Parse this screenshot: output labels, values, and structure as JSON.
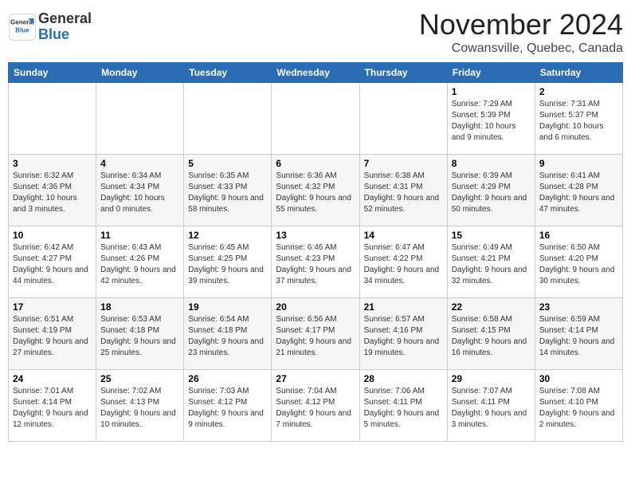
{
  "logo": {
    "general": "General",
    "blue": "Blue"
  },
  "title": "November 2024",
  "subtitle": "Cowansville, Quebec, Canada",
  "days_of_week": [
    "Sunday",
    "Monday",
    "Tuesday",
    "Wednesday",
    "Thursday",
    "Friday",
    "Saturday"
  ],
  "weeks": [
    [
      {
        "day": "",
        "info": ""
      },
      {
        "day": "",
        "info": ""
      },
      {
        "day": "",
        "info": ""
      },
      {
        "day": "",
        "info": ""
      },
      {
        "day": "",
        "info": ""
      },
      {
        "day": "1",
        "info": "Sunrise: 7:29 AM\nSunset: 5:39 PM\nDaylight: 10 hours and 9 minutes."
      },
      {
        "day": "2",
        "info": "Sunrise: 7:31 AM\nSunset: 5:37 PM\nDaylight: 10 hours and 6 minutes."
      }
    ],
    [
      {
        "day": "3",
        "info": "Sunrise: 6:32 AM\nSunset: 4:36 PM\nDaylight: 10 hours and 3 minutes."
      },
      {
        "day": "4",
        "info": "Sunrise: 6:34 AM\nSunset: 4:34 PM\nDaylight: 10 hours and 0 minutes."
      },
      {
        "day": "5",
        "info": "Sunrise: 6:35 AM\nSunset: 4:33 PM\nDaylight: 9 hours and 58 minutes."
      },
      {
        "day": "6",
        "info": "Sunrise: 6:36 AM\nSunset: 4:32 PM\nDaylight: 9 hours and 55 minutes."
      },
      {
        "day": "7",
        "info": "Sunrise: 6:38 AM\nSunset: 4:31 PM\nDaylight: 9 hours and 52 minutes."
      },
      {
        "day": "8",
        "info": "Sunrise: 6:39 AM\nSunset: 4:29 PM\nDaylight: 9 hours and 50 minutes."
      },
      {
        "day": "9",
        "info": "Sunrise: 6:41 AM\nSunset: 4:28 PM\nDaylight: 9 hours and 47 minutes."
      }
    ],
    [
      {
        "day": "10",
        "info": "Sunrise: 6:42 AM\nSunset: 4:27 PM\nDaylight: 9 hours and 44 minutes."
      },
      {
        "day": "11",
        "info": "Sunrise: 6:43 AM\nSunset: 4:26 PM\nDaylight: 9 hours and 42 minutes."
      },
      {
        "day": "12",
        "info": "Sunrise: 6:45 AM\nSunset: 4:25 PM\nDaylight: 9 hours and 39 minutes."
      },
      {
        "day": "13",
        "info": "Sunrise: 6:46 AM\nSunset: 4:23 PM\nDaylight: 9 hours and 37 minutes."
      },
      {
        "day": "14",
        "info": "Sunrise: 6:47 AM\nSunset: 4:22 PM\nDaylight: 9 hours and 34 minutes."
      },
      {
        "day": "15",
        "info": "Sunrise: 6:49 AM\nSunset: 4:21 PM\nDaylight: 9 hours and 32 minutes."
      },
      {
        "day": "16",
        "info": "Sunrise: 6:50 AM\nSunset: 4:20 PM\nDaylight: 9 hours and 30 minutes."
      }
    ],
    [
      {
        "day": "17",
        "info": "Sunrise: 6:51 AM\nSunset: 4:19 PM\nDaylight: 9 hours and 27 minutes."
      },
      {
        "day": "18",
        "info": "Sunrise: 6:53 AM\nSunset: 4:18 PM\nDaylight: 9 hours and 25 minutes."
      },
      {
        "day": "19",
        "info": "Sunrise: 6:54 AM\nSunset: 4:18 PM\nDaylight: 9 hours and 23 minutes."
      },
      {
        "day": "20",
        "info": "Sunrise: 6:56 AM\nSunset: 4:17 PM\nDaylight: 9 hours and 21 minutes."
      },
      {
        "day": "21",
        "info": "Sunrise: 6:57 AM\nSunset: 4:16 PM\nDaylight: 9 hours and 19 minutes."
      },
      {
        "day": "22",
        "info": "Sunrise: 6:58 AM\nSunset: 4:15 PM\nDaylight: 9 hours and 16 minutes."
      },
      {
        "day": "23",
        "info": "Sunrise: 6:59 AM\nSunset: 4:14 PM\nDaylight: 9 hours and 14 minutes."
      }
    ],
    [
      {
        "day": "24",
        "info": "Sunrise: 7:01 AM\nSunset: 4:14 PM\nDaylight: 9 hours and 12 minutes."
      },
      {
        "day": "25",
        "info": "Sunrise: 7:02 AM\nSunset: 4:13 PM\nDaylight: 9 hours and 10 minutes."
      },
      {
        "day": "26",
        "info": "Sunrise: 7:03 AM\nSunset: 4:12 PM\nDaylight: 9 hours and 9 minutes."
      },
      {
        "day": "27",
        "info": "Sunrise: 7:04 AM\nSunset: 4:12 PM\nDaylight: 9 hours and 7 minutes."
      },
      {
        "day": "28",
        "info": "Sunrise: 7:06 AM\nSunset: 4:11 PM\nDaylight: 9 hours and 5 minutes."
      },
      {
        "day": "29",
        "info": "Sunrise: 7:07 AM\nSunset: 4:11 PM\nDaylight: 9 hours and 3 minutes."
      },
      {
        "day": "30",
        "info": "Sunrise: 7:08 AM\nSunset: 4:10 PM\nDaylight: 9 hours and 2 minutes."
      }
    ]
  ]
}
